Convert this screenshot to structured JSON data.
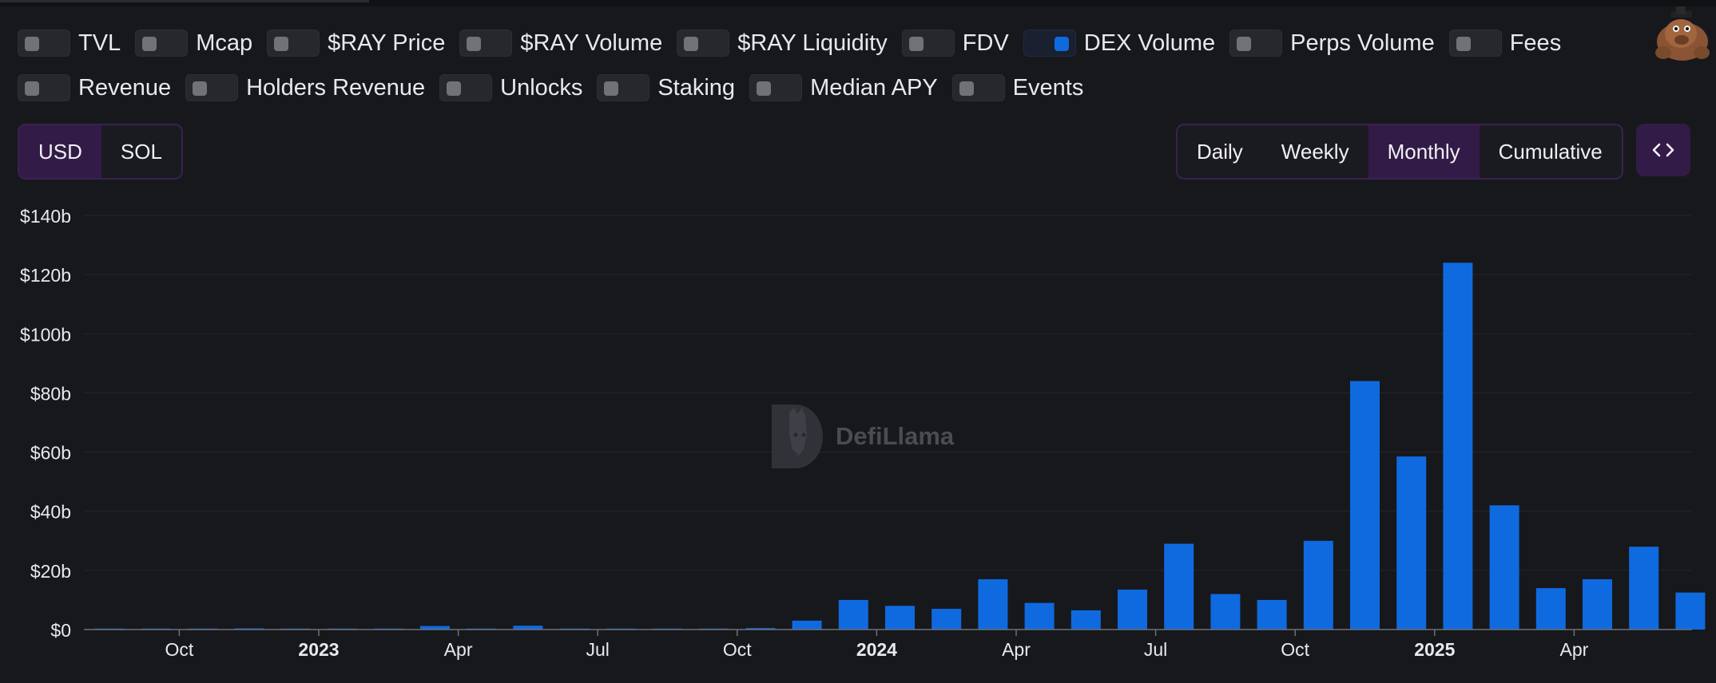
{
  "toggles": {
    "row1": [
      {
        "label": "TVL",
        "on": false
      },
      {
        "label": "Mcap",
        "on": false
      },
      {
        "label": "$RAY Price",
        "on": false
      },
      {
        "label": "$RAY Volume",
        "on": false
      },
      {
        "label": "$RAY Liquidity",
        "on": false
      },
      {
        "label": "FDV",
        "on": false
      },
      {
        "label": "DEX Volume",
        "on": true
      },
      {
        "label": "Perps Volume",
        "on": false
      },
      {
        "label": "Fees",
        "on": false
      }
    ],
    "row2": [
      {
        "label": "Revenue",
        "on": false
      },
      {
        "label": "Holders Revenue",
        "on": false
      },
      {
        "label": "Unlocks",
        "on": false
      },
      {
        "label": "Staking",
        "on": false
      },
      {
        "label": "Median APY",
        "on": false
      },
      {
        "label": "Events",
        "on": false
      }
    ]
  },
  "currency": {
    "options": [
      "USD",
      "SOL"
    ],
    "selected": "USD"
  },
  "period": {
    "options": [
      "Daily",
      "Weekly",
      "Monthly",
      "Cumulative"
    ],
    "selected": "Monthly"
  },
  "embed_icon": "code-icon",
  "watermark": "DefiLlama",
  "colors": {
    "accent": "#0f6ae0",
    "background": "#17181c",
    "selected": "#331b48"
  },
  "chart_data": {
    "type": "bar",
    "series": [
      {
        "name": "DEX Volume",
        "unit": "USD billions"
      }
    ],
    "categories": [
      "2022-08",
      "2022-09",
      "2022-10",
      "2022-11",
      "2022-12",
      "2023-01",
      "2023-02",
      "2023-03",
      "2023-04",
      "2023-05",
      "2023-06",
      "2023-07",
      "2023-08",
      "2023-09",
      "2023-10",
      "2023-11",
      "2023-12",
      "2024-01",
      "2024-02",
      "2024-03",
      "2024-04",
      "2024-05",
      "2024-06",
      "2024-07",
      "2024-08",
      "2024-09",
      "2024-10",
      "2024-11",
      "2024-12",
      "2025-01",
      "2025-02",
      "2025-03",
      "2025-04",
      "2025-05",
      "2025-06"
    ],
    "values": [
      0.2,
      0.3,
      0.3,
      0.4,
      0.2,
      0.3,
      0.3,
      1.2,
      0.3,
      1.3,
      0.2,
      0.3,
      0.2,
      0.2,
      0.5,
      3,
      10,
      8,
      7,
      17,
      9,
      6.5,
      13.5,
      29,
      12,
      10,
      30,
      84,
      58.5,
      124,
      42,
      14,
      17,
      28,
      12.5
    ],
    "ylim": [
      0,
      140
    ],
    "yticks": [
      "$0",
      "$20b",
      "$40b",
      "$60b",
      "$80b",
      "$100b",
      "$120b",
      "$140b"
    ],
    "xticks": [
      {
        "label": "Oct",
        "date": "2022-10",
        "bold": false
      },
      {
        "label": "2023",
        "date": "2023-01",
        "bold": true
      },
      {
        "label": "Apr",
        "date": "2023-04",
        "bold": false
      },
      {
        "label": "Jul",
        "date": "2023-07",
        "bold": false
      },
      {
        "label": "Oct",
        "date": "2023-10",
        "bold": false
      },
      {
        "label": "2024",
        "date": "2024-01",
        "bold": true
      },
      {
        "label": "Apr",
        "date": "2024-04",
        "bold": false
      },
      {
        "label": "Jul",
        "date": "2024-07",
        "bold": false
      },
      {
        "label": "Oct",
        "date": "2024-10",
        "bold": false
      },
      {
        "label": "2025",
        "date": "2025-01",
        "bold": true
      },
      {
        "label": "Apr",
        "date": "2025-04",
        "bold": false
      }
    ],
    "grid": true,
    "legend": "toggles at top"
  }
}
